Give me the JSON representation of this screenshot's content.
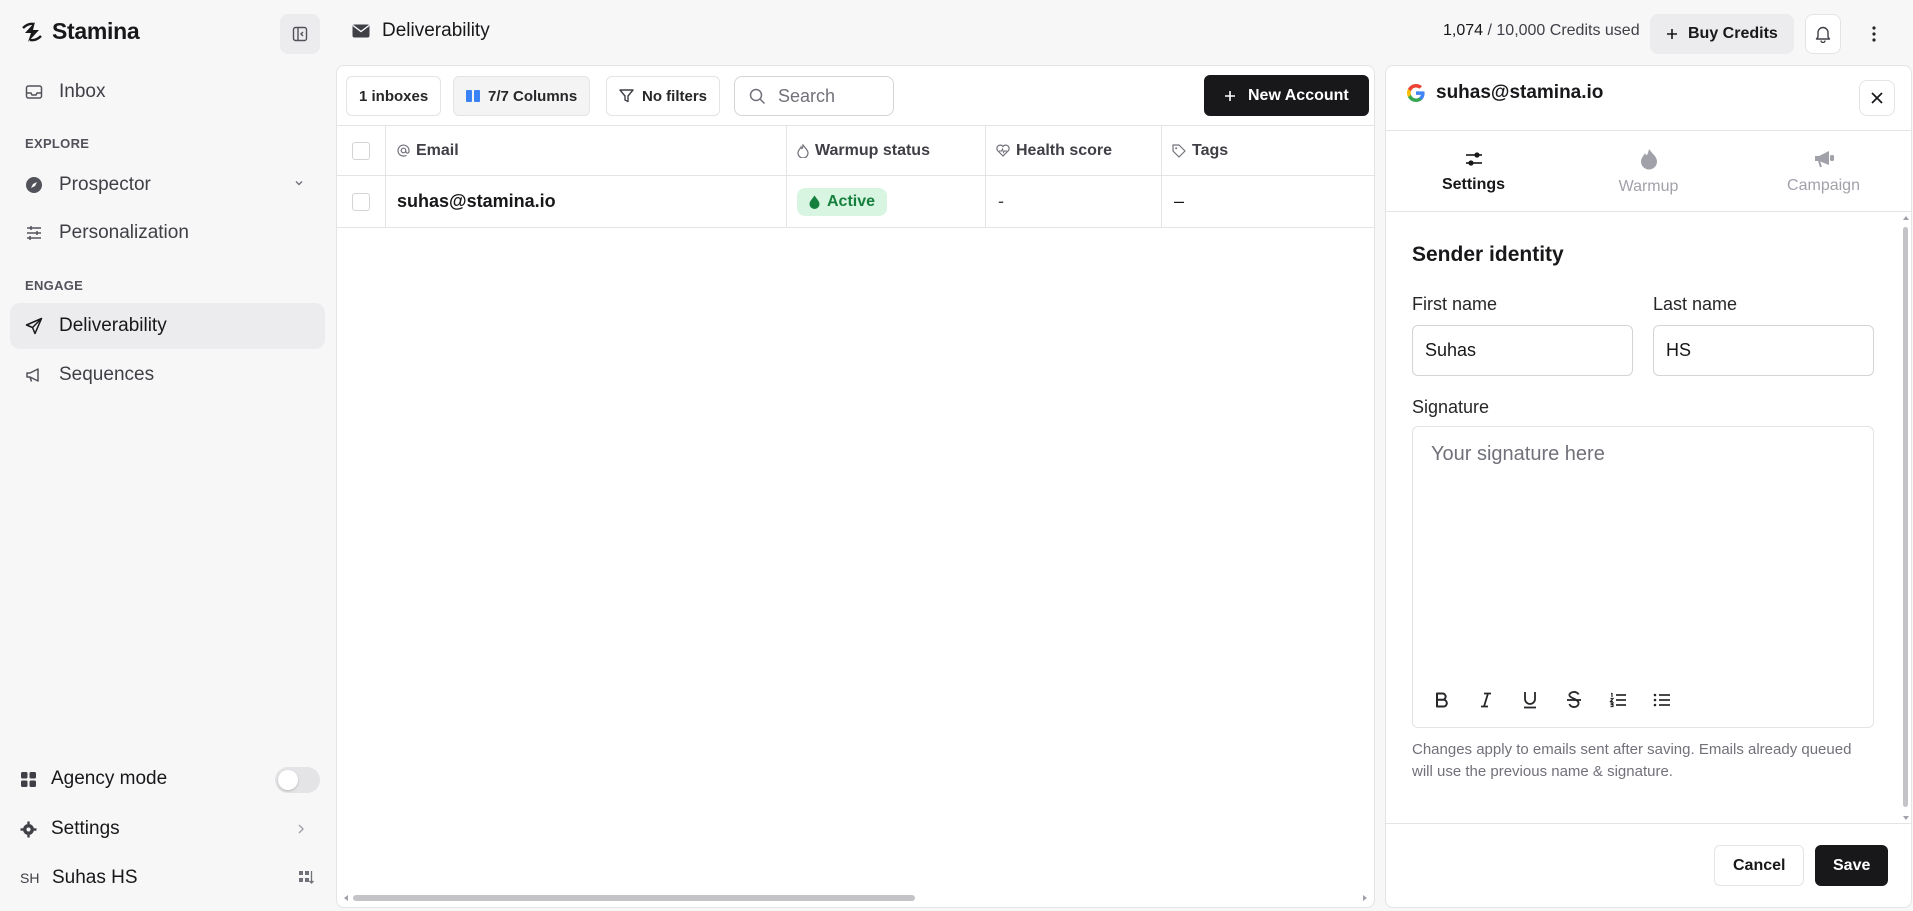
{
  "app": {
    "name": "Stamina"
  },
  "sidebar": {
    "inbox": "Inbox",
    "explore_label": "EXPLORE",
    "prospector": "Prospector",
    "personalization": "Personalization",
    "engage_label": "ENGAGE",
    "deliverability": "Deliverability",
    "sequences": "Sequences",
    "agency_mode": "Agency mode",
    "agency_mode_on": false,
    "settings": "Settings",
    "user_initials": "SH",
    "user_name": "Suhas HS"
  },
  "header": {
    "title": "Deliverability",
    "credits_used": "1,074",
    "credits_total": "/ 10,000 Credits used",
    "buy_credits": "Buy Credits"
  },
  "toolbar": {
    "inboxes": "1 inboxes",
    "columns": "7/7 Columns",
    "filters": "No filters",
    "search_placeholder": "Search",
    "new_account": "New Account"
  },
  "table": {
    "columns": [
      "Email",
      "Warmup status",
      "Health score",
      "Tags"
    ],
    "rows": [
      {
        "email": "suhas@stamina.io",
        "warmup_status": "Active",
        "health_score": "-",
        "tags": "–"
      }
    ]
  },
  "panel": {
    "account": "suhas@stamina.io",
    "tabs": [
      "Settings",
      "Warmup",
      "Campaign"
    ],
    "active_tab": "Settings",
    "section_title": "Sender identity",
    "first_name_label": "First name",
    "first_name_value": "Suhas",
    "last_name_label": "Last name",
    "last_name_value": "HS",
    "signature_label": "Signature",
    "signature_placeholder": "Your signature here",
    "help_text": "Changes apply to emails sent after saving. Emails already queued will use the previous name & signature.",
    "cancel": "Cancel",
    "save": "Save"
  },
  "colors": {
    "primary": "#18181b",
    "active_badge_bg": "#d8f5e1",
    "active_badge_text": "#15803d",
    "columns_icon": "#3b82f6"
  }
}
